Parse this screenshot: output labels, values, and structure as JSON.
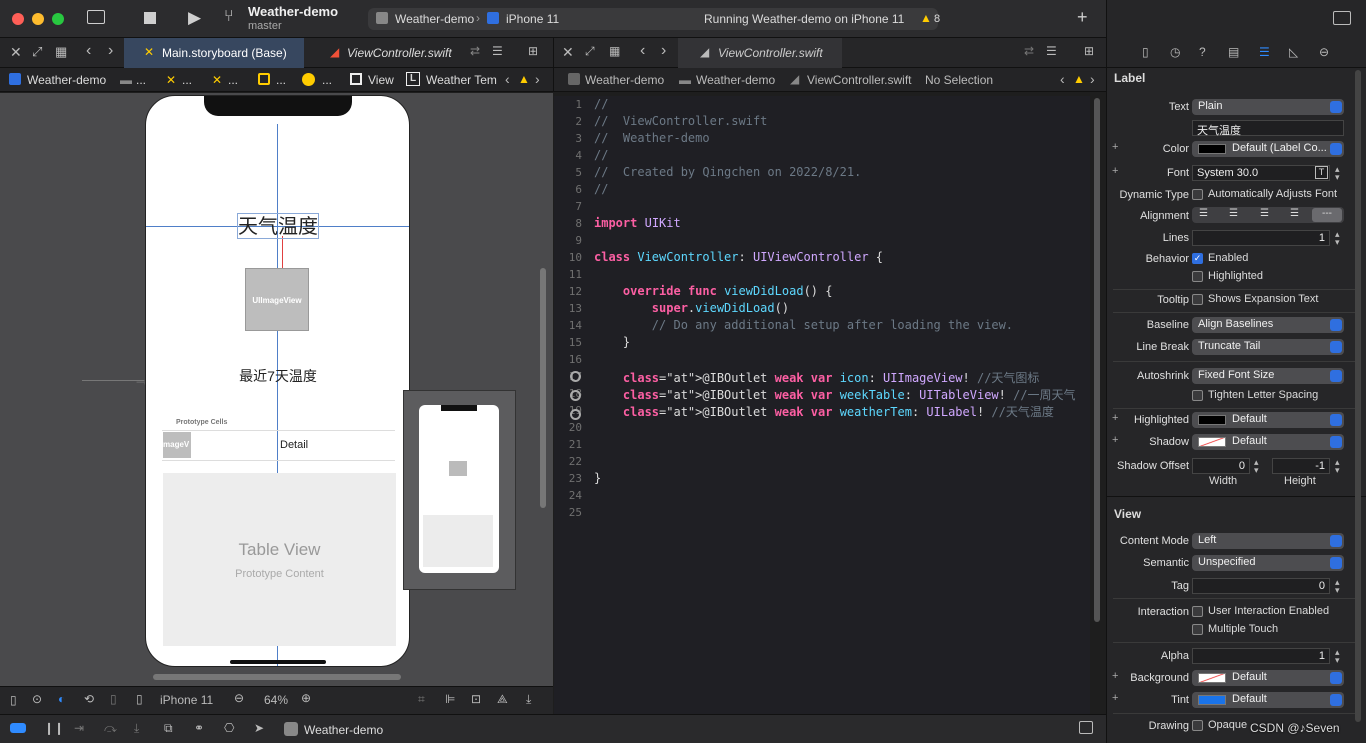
{
  "toolbar": {
    "project": "Weather-demo",
    "branch": "master",
    "scheme": "Weather-demo",
    "device": "iPhone 11",
    "status": "Running Weather-demo on iPhone 11",
    "warnings": "8"
  },
  "left_editor": {
    "tab_active": "Main.storyboard (Base)",
    "tab_inactive": "ViewController.swift",
    "jump_bar": [
      "Weather-demo",
      "...",
      "...",
      "...",
      "...",
      "...",
      "View",
      "Weather Tem"
    ],
    "canvas": {
      "label_title": "天气温度",
      "image_view": "UIImageView",
      "label_sub": "最近7天温度",
      "prototype_cells": "Prototype Cells",
      "cell_image": "mageV",
      "cell_detail": "Detail",
      "table_view": "Table View",
      "prototype_content": "Prototype Content"
    },
    "bottom_bar": {
      "device": "iPhone 11",
      "zoom": "64%"
    }
  },
  "right_editor": {
    "tab": "ViewController.swift",
    "jump_bar": [
      "Weather-demo",
      "Weather-demo",
      "ViewController.swift",
      "No Selection"
    ],
    "lines": [
      {
        "n": "1",
        "t": "//"
      },
      {
        "n": "2",
        "t": "//  ViewController.swift"
      },
      {
        "n": "3",
        "t": "//  Weather-demo"
      },
      {
        "n": "4",
        "t": "//"
      },
      {
        "n": "5",
        "t": "//  Created by Qingchen on 2022/8/21."
      },
      {
        "n": "6",
        "t": "//"
      },
      {
        "n": "7",
        "t": ""
      },
      {
        "n": "8",
        "t": "import UIKit"
      },
      {
        "n": "9",
        "t": ""
      },
      {
        "n": "10",
        "t": "class ViewController: UIViewController {"
      },
      {
        "n": "11",
        "t": ""
      },
      {
        "n": "12",
        "t": "    override func viewDidLoad() {"
      },
      {
        "n": "13",
        "t": "        super.viewDidLoad()"
      },
      {
        "n": "14",
        "t": "        // Do any additional setup after loading the view."
      },
      {
        "n": "15",
        "t": "    }"
      },
      {
        "n": "16",
        "t": ""
      },
      {
        "n": "17",
        "t": "    @IBOutlet weak var icon: UIImageView! //天气图标"
      },
      {
        "n": "18",
        "t": "    @IBOutlet weak var weekTable: UITableView! //一周天气"
      },
      {
        "n": "19",
        "t": "    @IBOutlet weak var weatherTem: UILabel! //天气温度"
      },
      {
        "n": "20",
        "t": ""
      },
      {
        "n": "21",
        "t": ""
      },
      {
        "n": "22",
        "t": ""
      },
      {
        "n": "23",
        "t": "}"
      },
      {
        "n": "24",
        "t": ""
      },
      {
        "n": "25",
        "t": ""
      }
    ]
  },
  "debug_bar": {
    "target": "Weather-demo"
  },
  "inspector": {
    "label_section": "Label",
    "text_label": "Text",
    "text_value": "Plain",
    "text_content": "天气温度",
    "color_label": "Color",
    "color_value": "Default (Label Co...",
    "font_label": "Font",
    "font_value": "System 30.0",
    "dynamic_type_label": "Dynamic Type",
    "dynamic_type_value": "Automatically Adjusts Font",
    "alignment_label": "Alignment",
    "lines_label": "Lines",
    "lines_value": "1",
    "behavior_label": "Behavior",
    "enabled": "Enabled",
    "highlighted_chk": "Highlighted",
    "tooltip_label": "Tooltip",
    "tooltip_value": "Shows Expansion Text",
    "baseline_label": "Baseline",
    "baseline_value": "Align Baselines",
    "line_break_label": "Line Break",
    "line_break_value": "Truncate Tail",
    "autoshrink_label": "Autoshrink",
    "autoshrink_value": "Fixed Font Size",
    "tighten": "Tighten Letter Spacing",
    "highlighted_label": "Highlighted",
    "highlighted_value": "Default",
    "shadow_label": "Shadow",
    "shadow_value": "Default",
    "shadow_offset_label": "Shadow Offset",
    "shadow_w": "0",
    "shadow_h": "-1",
    "width_label": "Width",
    "height_label": "Height",
    "view_section": "View",
    "content_mode_label": "Content Mode",
    "content_mode_value": "Left",
    "semantic_label": "Semantic",
    "semantic_value": "Unspecified",
    "tag_label": "Tag",
    "tag_value": "0",
    "interaction_label": "Interaction",
    "user_interaction": "User Interaction Enabled",
    "multiple_touch": "Multiple Touch",
    "alpha_label": "Alpha",
    "alpha_value": "1",
    "background_label": "Background",
    "background_value": "Default",
    "tint_label": "Tint",
    "tint_value": "Default",
    "drawing_label": "Drawing",
    "opaque": "Opaque",
    "watermark": "CSDN @♪Seven"
  },
  "colors": {
    "accent": "#2f6fe0",
    "keyword": "#fc5fa3",
    "type": "#5dd8ff",
    "comment": "#6c7986"
  }
}
